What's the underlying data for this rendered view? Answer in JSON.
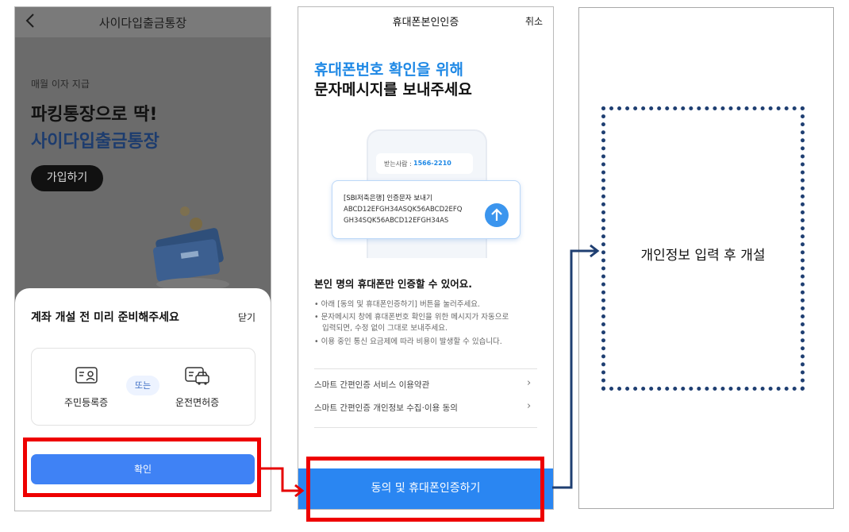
{
  "screen1": {
    "header": {
      "back_icon": "chevron-left-icon",
      "title": "사이다입출금통장"
    },
    "banner": {
      "subtitle": "매월 이자 지급",
      "headline_line1": "파킹통장으로 딱!",
      "headline_line2": "사이다입출금통장",
      "join_button": "가입하기"
    },
    "sheet": {
      "title": "계좌 개설 전 미리 준비해주세요",
      "close_label": "닫기",
      "option1_label": "주민등록증",
      "option1_icon": "id-card-icon",
      "or_label": "또는",
      "option2_label": "운전면허증",
      "option2_icon": "driver-license-icon",
      "confirm_button": "확인"
    }
  },
  "screen2": {
    "header": {
      "title": "휴대폰본인인증",
      "cancel_label": "취소"
    },
    "headline_line1": "휴대폰번호 확인을 위해",
    "headline_line2": "문자메시지를 보내주세요",
    "illustration": {
      "recipient_label": "받는사람 :",
      "recipient_number": "1566-2210",
      "message_title": "[SBI저축은행] 인증문자 보내기",
      "message_line1": "ABCD12EFGH34ASQK56ABCD2EFQ",
      "message_line2": "GH34SQK56ABCD12EFGH34AS",
      "send_icon": "arrow-up-icon"
    },
    "notice_title": "본인 명의 휴대폰만 인증할 수 있어요.",
    "notices": [
      "• 아래 [동의 및 휴대폰인증하기] 버튼을 눌러주세요.",
      "• 문자메시지 창에 휴대폰번호 확인을 위한 메시지가 자동으로",
      "입력되면, 수정 없이 그대로 보내주세요.",
      "• 이용 중인 통신 요금제에 따라 비용이 발생할 수 있습니다."
    ],
    "terms": [
      {
        "label": "스마트 간편인증 서비스 이용약관",
        "icon": "chevron-right-icon"
      },
      {
        "label": "스마트 간편인증 개인정보 수집·이용 동의",
        "icon": "chevron-right-icon"
      }
    ],
    "cta_button": "동의 및 휴대폰인증하기"
  },
  "screen3": {
    "placeholder_text": "개인정보 입력 후 개설"
  },
  "colors": {
    "highlight_red": "#ee0000",
    "arrow_red": "#e60000",
    "arrow_navy": "#1f3f72",
    "brand_blue": "#1e88e5",
    "button_blue": "#3f82f5"
  }
}
